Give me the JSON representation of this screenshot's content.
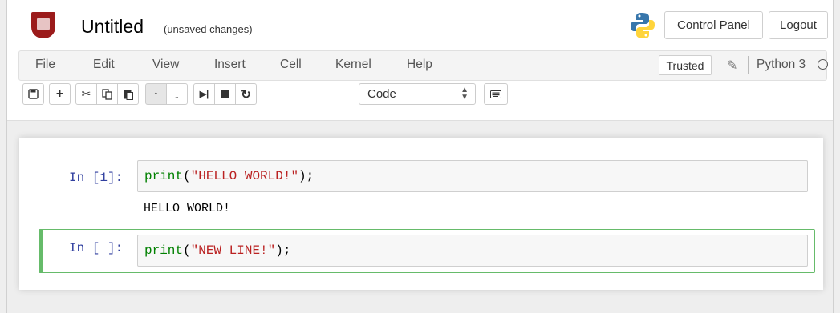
{
  "header": {
    "title": "Untitled",
    "save_status": "(unsaved changes)",
    "control_panel_label": "Control Panel",
    "logout_label": "Logout"
  },
  "menubar": {
    "items": [
      "File",
      "Edit",
      "View",
      "Insert",
      "Cell",
      "Kernel",
      "Help"
    ],
    "trusted_label": "Trusted",
    "kernel_name": "Python 3"
  },
  "toolbar": {
    "cell_type": "Code",
    "cell_type_options": [
      "Code"
    ]
  },
  "cells": [
    {
      "prompt": "In [1]:",
      "code_fn": "print",
      "code_open": "(",
      "code_str": "\"HELLO WORLD!\"",
      "code_close": ");",
      "output": "HELLO WORLD!"
    },
    {
      "prompt": "In [ ]:",
      "code_fn": "print",
      "code_open": "(",
      "code_str": "\"NEW LINE!\"",
      "code_close": ");"
    }
  ],
  "colors": {
    "prompt": "#303f9f",
    "keyword": "#008000",
    "string": "#ba2121",
    "selected_cell_border": "#66bb6a"
  }
}
